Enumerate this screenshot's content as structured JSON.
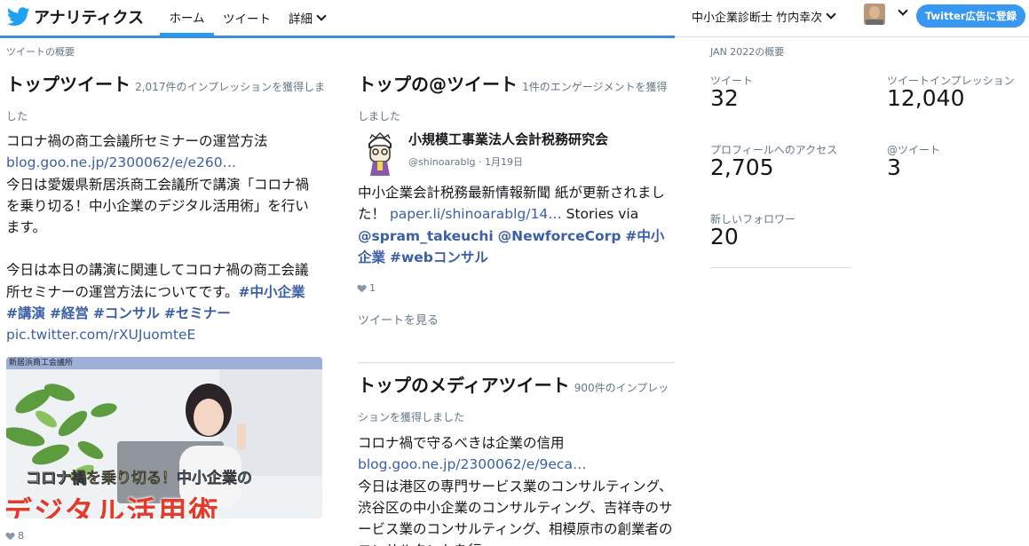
{
  "header": {
    "brand": "アナリティクス",
    "nav": [
      {
        "label": "ホーム",
        "active": true
      },
      {
        "label": "ツイート",
        "active": false
      },
      {
        "label": "詳細",
        "active": false
      }
    ],
    "account_name": "中小企業診断士 竹内幸次",
    "ads_button": "Twitter広告に登録",
    "accent_color": "#1da1f2"
  },
  "tweets_overview_label": "ツイートの概要",
  "top_tweet": {
    "title": "トップツイート",
    "subtitle": "2,017件のインプレッションを獲得しました",
    "headline": "コロナ禍の商工会議所セミナーの運営方法",
    "link": "blog.goo.ne.jp/2300062/e/e260…",
    "text1": "今日は愛媛県新居浜商工会議所で講演「コロナ禍を乗り切る！中小企業のデジタル活用術」を行います。",
    "text2": "今日は本日の講演に関連してコロナ禍の商工会議所セミナーの運営方法についてです。",
    "hashtags": [
      "#中小企業",
      "#講演",
      "#経営",
      "#コンサル",
      "#セミナー"
    ],
    "pic_link": "pic.twitter.com/rXUJuomteE",
    "image_strip_text": "新居浜商工会議所",
    "image_overlay_line1a": "コロナ禍",
    "image_overlay_line1b": "を乗り切る！",
    "image_overlay_line1c": "中小企業の",
    "image_overlay_line2": "デジタル活用術",
    "likes": "8"
  },
  "top_mention": {
    "title": "トップの@ツイート",
    "subtitle": "1件のエンゲージメントを獲得しました",
    "name": "小規模工事業法人会計税務研究会",
    "handle": "@shinoarablg",
    "date": "1月19日",
    "text_pre": "中小企業会計税務最新情報新聞 紙が更新されました！",
    "link": "paper.li/shinoarablg/14…",
    "text_mid": "Stories via",
    "mentions": [
      "@spram_takeuchi",
      "@NewforceCorp"
    ],
    "hashtags": [
      "#中小企業",
      "#webコンサル"
    ],
    "likes": "1",
    "see_tweet": "ツイートを見る"
  },
  "top_media": {
    "title": "トップのメディアツイート",
    "subtitle": "900件のインプレッションを獲得しました",
    "headline": "コロナ禍で守るべきは企業の信用",
    "link": "blog.goo.ne.jp/2300062/e/9eca…",
    "text": "今日は港区の専門サービス業のコンサルティング、渋谷区の中小企業のコンサルティング、吉祥寺のサービス業のコンサルティング、相模原市の創業者のコンサルタントを行"
  },
  "summary": {
    "period_label": "JAN 2022の概要",
    "stats": [
      {
        "label": "ツイート",
        "value": "32"
      },
      {
        "label": "ツイートインプレッション",
        "value": "12,040"
      },
      {
        "label": "プロフィールへのアクセス",
        "value": "2,705"
      },
      {
        "label": "@ツイート",
        "value": "3"
      },
      {
        "label": "新しいフォロワー",
        "value": "20"
      }
    ]
  }
}
